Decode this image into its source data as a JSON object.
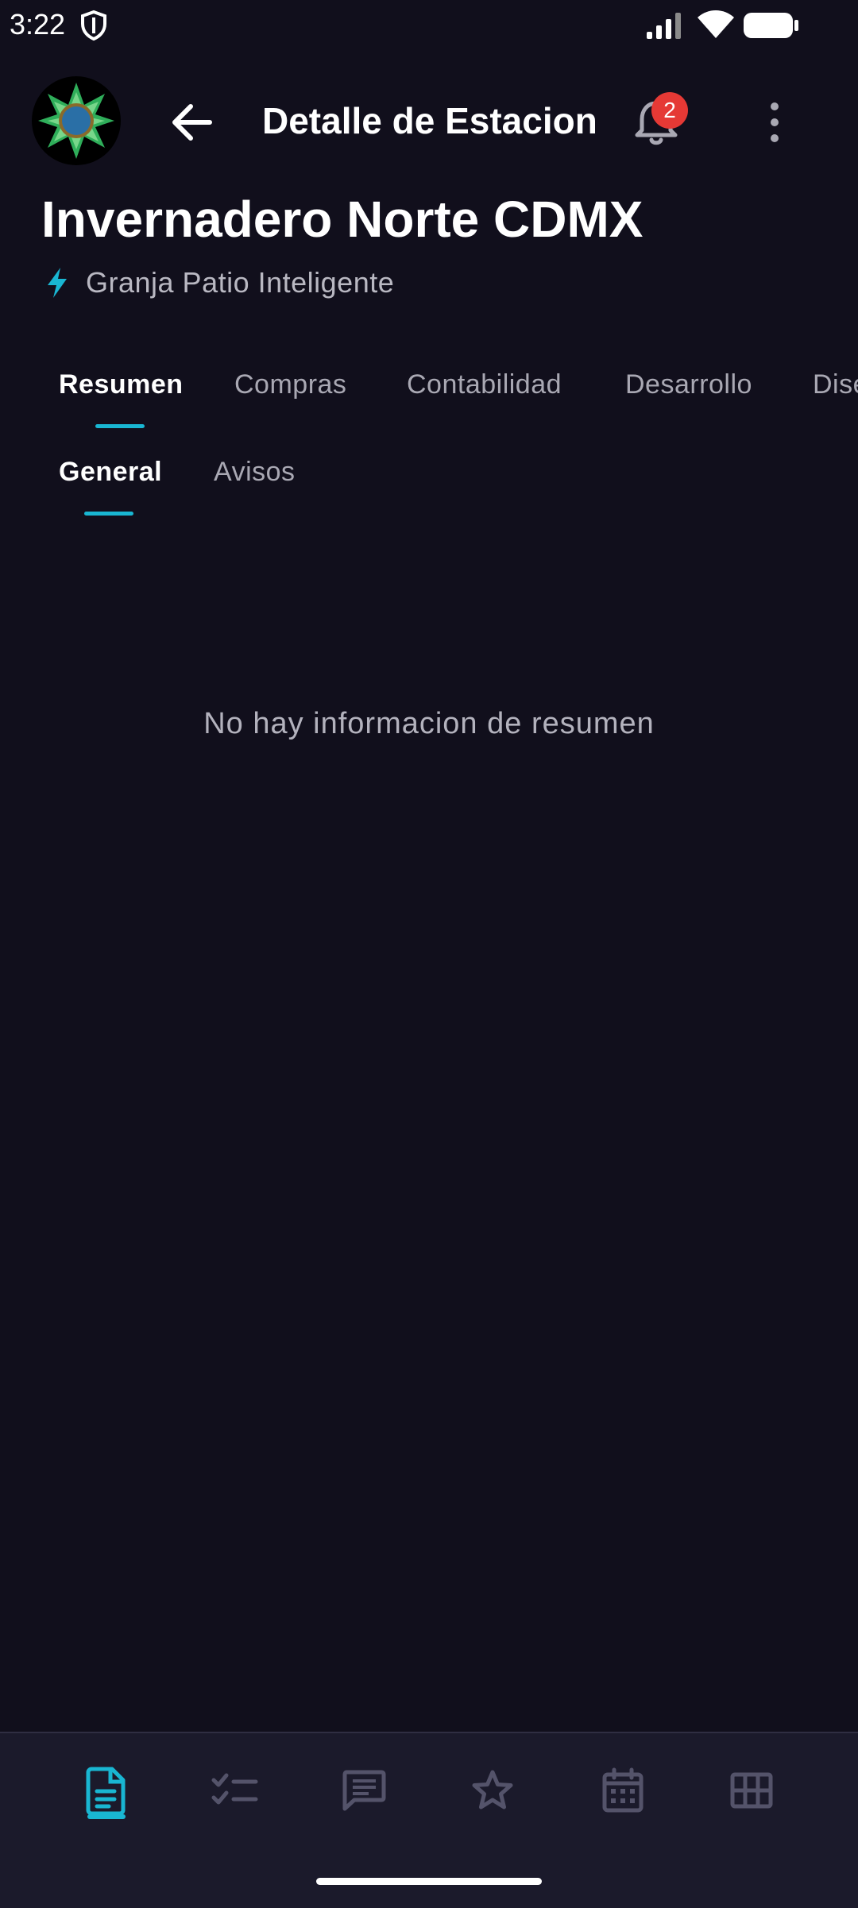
{
  "status_bar": {
    "time": "3:22"
  },
  "app_bar": {
    "title": "Detalle de Estacion",
    "notification_count": "2"
  },
  "station": {
    "name": "Invernadero Norte CDMX",
    "subtitle": "Granja Patio Inteligente"
  },
  "main_tabs": [
    {
      "label": "Resumen",
      "active": true
    },
    {
      "label": "Compras",
      "active": false
    },
    {
      "label": "Contabilidad",
      "active": false
    },
    {
      "label": "Desarrollo",
      "active": false
    },
    {
      "label": "Diseño",
      "active": false
    }
  ],
  "sub_tabs": [
    {
      "label": "General",
      "active": true
    },
    {
      "label": "Avisos",
      "active": false
    }
  ],
  "content": {
    "empty_message": "No hay informacion de resumen"
  },
  "bottom_nav": [
    {
      "icon": "document-icon",
      "active": true
    },
    {
      "icon": "checklist-icon",
      "active": false
    },
    {
      "icon": "chat-icon",
      "active": false
    },
    {
      "icon": "star-icon",
      "active": false
    },
    {
      "icon": "calendar-icon",
      "active": false
    },
    {
      "icon": "grid-icon",
      "active": false
    }
  ],
  "colors": {
    "background": "#110f1c",
    "accent": "#19b6d2",
    "badge": "#e53935",
    "nav_background": "#1b1a2b"
  }
}
